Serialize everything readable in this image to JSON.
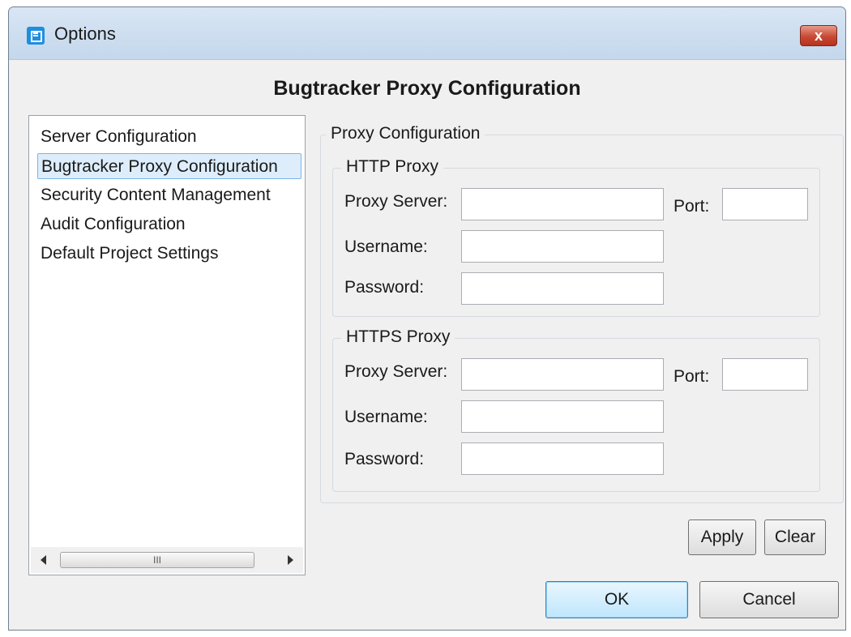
{
  "window": {
    "title": "Options",
    "close_label": "x"
  },
  "heading": "Bugtracker Proxy Configuration",
  "nav": {
    "items": [
      {
        "label": "Server Configuration"
      },
      {
        "label": "Bugtracker Proxy Configuration",
        "selected": true
      },
      {
        "label": "Security Content Management"
      },
      {
        "label": "Audit Configuration"
      },
      {
        "label": "Default Project Settings"
      }
    ],
    "scroll_thumb_grip": "III"
  },
  "proxy_config": {
    "legend": "Proxy Configuration",
    "http": {
      "legend": "HTTP Proxy",
      "server_label": "Proxy Server:",
      "port_label": "Port:",
      "username_label": "Username:",
      "password_label": "Password:",
      "server_value": "",
      "port_value": "",
      "username_value": "",
      "password_value": ""
    },
    "https": {
      "legend": "HTTPS Proxy",
      "server_label": "Proxy Server:",
      "port_label": "Port:",
      "username_label": "Username:",
      "password_label": "Password:",
      "server_value": "",
      "port_value": "",
      "username_value": "",
      "password_value": ""
    }
  },
  "buttons": {
    "apply": "Apply",
    "clear": "Clear",
    "ok": "OK",
    "cancel": "Cancel"
  }
}
